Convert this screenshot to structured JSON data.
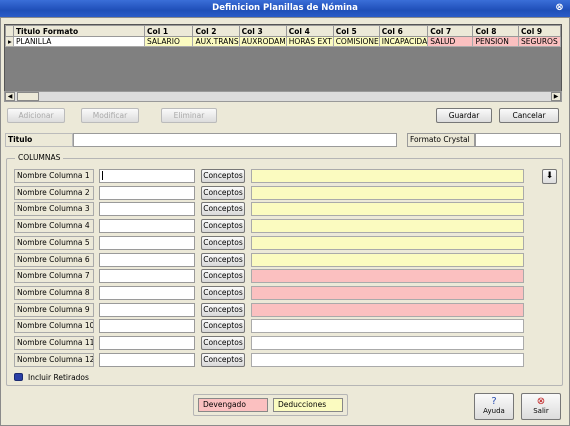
{
  "window": {
    "title": "Definicion Planillas de Nómina"
  },
  "grid": {
    "headers": [
      "Titulo Formato",
      "Col 1",
      "Col 2",
      "Col 3",
      "Col 4",
      "Col 5",
      "Col 6",
      "Col 7",
      "Col 8",
      "Col 9"
    ],
    "row": [
      "PLANILLA",
      "SALARIO",
      "AUX.TRANS",
      "AUXRODAM",
      "HORAS EXT",
      "COMISIONE",
      "INCAPACIDA",
      "SALUD",
      "PENSION",
      "SEGUROS"
    ]
  },
  "toolbar": {
    "adicionar": "Adicionar",
    "modificar": "Modificar",
    "eliminar": "Eliminar",
    "guardar": "Guardar",
    "cancelar": "Cancelar"
  },
  "form": {
    "titulo_label": "Titulo",
    "formato_crystal_label": "Formato Crystal",
    "columnas_legend": "COLUMNAS",
    "conceptos_label": "Conceptos",
    "incluir_retirados": "Incluir Retirados",
    "columns": [
      "Nombre Columna 1",
      "Nombre Columna 2",
      "Nombre Columna 3",
      "Nombre Columna 4",
      "Nombre Columna 5",
      "Nombre Columna 6",
      "Nombre Columna 7",
      "Nombre Columna 8",
      "Nombre Columna 9",
      "Nombre Columna 10",
      "Nombre Columna 11",
      "Nombre Columna 12"
    ]
  },
  "legend": {
    "devengado": "Devengado",
    "deducciones": "Deducciones"
  },
  "footer": {
    "ayuda": "Ayuda",
    "salir": "Salir"
  },
  "colors": {
    "devengado": "#fbc0c0",
    "deducciones": "#fbfbc0",
    "titlebar": "#1f4fb8"
  }
}
